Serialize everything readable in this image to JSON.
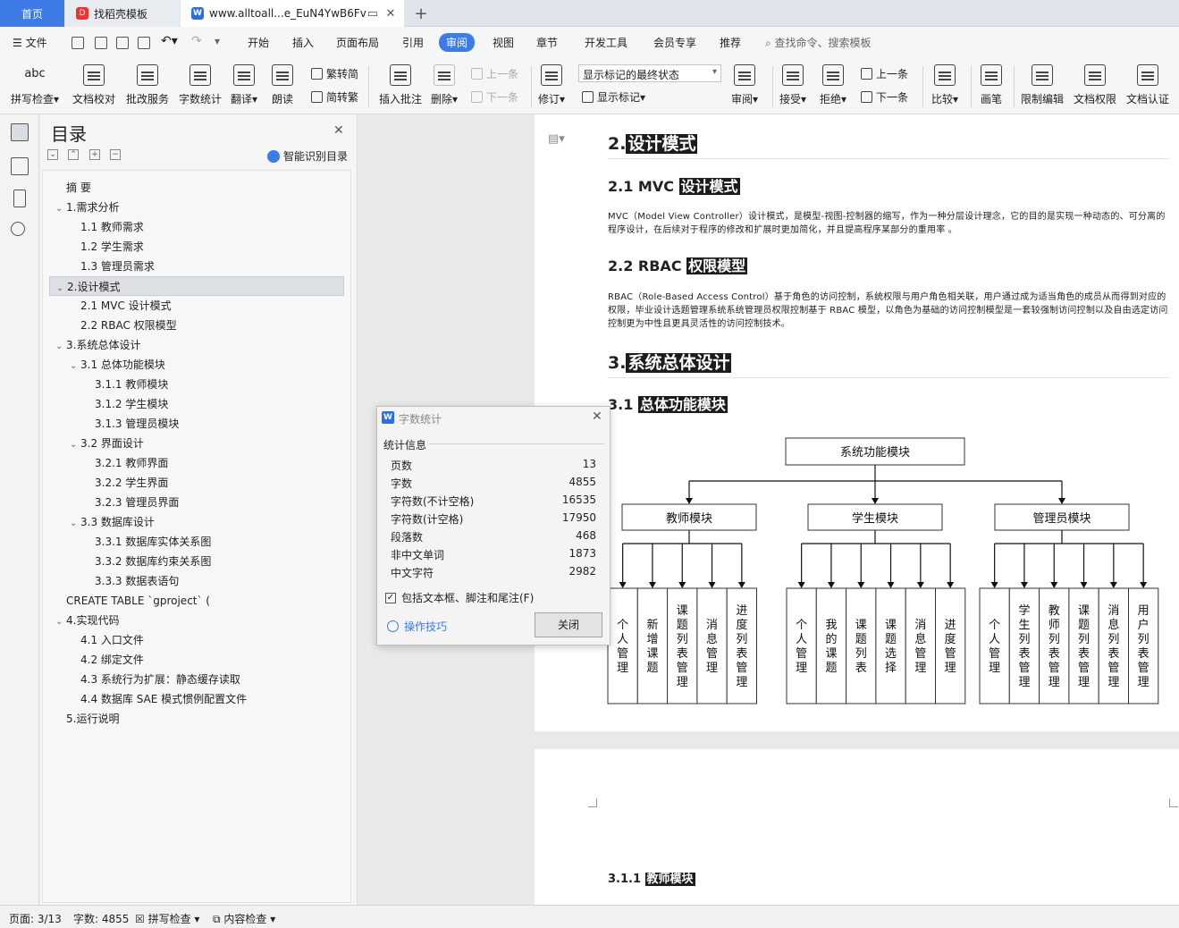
{
  "tabs": {
    "home": "首页",
    "template": "找稻壳模板",
    "doc": "www.alltoall...e_EuN4YwB6Fv"
  },
  "menu": [
    "文件",
    "开始",
    "插入",
    "页面布局",
    "引用",
    "审阅",
    "视图",
    "章节",
    "开发工具",
    "会员专享",
    "推荐"
  ],
  "search_placeholder": "查找命令、搜索模板",
  "ribbon": {
    "spell": "拼写检查",
    "proof": "文档校对",
    "batch": "批改服务",
    "wordcount": "字数统计",
    "translate": "翻译",
    "read": "朗读",
    "trad": "繁转简",
    "simp": "简转繁",
    "insert_comment": "插入批注",
    "delete": "删除",
    "prev_comment": "上一条",
    "next_comment": "下一条",
    "track": "修订",
    "markup_mode": "显示标记的最终状态",
    "show_markup": "显示标记",
    "review": "审阅",
    "accept": "接受",
    "reject": "拒绝",
    "prev_change": "上一条",
    "next_change": "下一条",
    "compare": "比较",
    "pen": "画笔",
    "restrict": "限制编辑",
    "permission": "文档权限",
    "certify": "文档认证",
    "abc": "abc"
  },
  "toc": {
    "title": "目录",
    "smart": "智能识别目录",
    "items": [
      {
        "text": "摘 要",
        "level": 0,
        "caret": ""
      },
      {
        "text": "1.需求分析",
        "level": 0,
        "caret": "v"
      },
      {
        "text": "1.1 教师需求",
        "level": 1,
        "caret": ""
      },
      {
        "text": "1.2 学生需求",
        "level": 1,
        "caret": ""
      },
      {
        "text": "1.3 管理员需求",
        "level": 1,
        "caret": ""
      },
      {
        "text": "2.设计模式",
        "level": 0,
        "caret": "v",
        "selected": true
      },
      {
        "text": "2.1 MVC 设计模式",
        "level": 1,
        "caret": ""
      },
      {
        "text": "2.2 RBAC 权限模型",
        "level": 1,
        "caret": ""
      },
      {
        "text": "3.系统总体设计",
        "level": 0,
        "caret": "v"
      },
      {
        "text": "3.1 总体功能模块",
        "level": 1,
        "caret": "v"
      },
      {
        "text": "3.1.1 教师模块",
        "level": 2,
        "caret": ""
      },
      {
        "text": "3.1.2 学生模块",
        "level": 2,
        "caret": ""
      },
      {
        "text": "3.1.3 管理员模块",
        "level": 2,
        "caret": ""
      },
      {
        "text": "3.2 界面设计",
        "level": 1,
        "caret": "v"
      },
      {
        "text": "3.2.1 教师界面",
        "level": 2,
        "caret": ""
      },
      {
        "text": "3.2.2 学生界面",
        "level": 2,
        "caret": ""
      },
      {
        "text": "3.2.3 管理员界面",
        "level": 2,
        "caret": ""
      },
      {
        "text": "3.3 数据库设计",
        "level": 1,
        "caret": "v"
      },
      {
        "text": "3.3.1 数据库实体关系图",
        "level": 2,
        "caret": ""
      },
      {
        "text": "3.3.2 数据库约束关系图",
        "level": 2,
        "caret": ""
      },
      {
        "text": "3.3.3 数据表语句",
        "level": 2,
        "caret": ""
      },
      {
        "text": "CREATE TABLE `gproject` (",
        "level": 0,
        "caret": ""
      },
      {
        "text": "4.实现代码",
        "level": 0,
        "caret": "v"
      },
      {
        "text": "4.1 入口文件",
        "level": 1,
        "caret": ""
      },
      {
        "text": "4.2 绑定文件",
        "level": 1,
        "caret": ""
      },
      {
        "text": "4.3 系统行为扩展：静态缓存读取",
        "level": 1,
        "caret": ""
      },
      {
        "text": "4.4 数据库 SAE 模式惯例配置文件",
        "level": 1,
        "caret": ""
      },
      {
        "text": "5.运行说明",
        "level": 0,
        "caret": ""
      }
    ]
  },
  "document": {
    "h_2": "2.",
    "h_2_text": "设计模式",
    "h_21": "2.1 MVC",
    "h_21_text": "设计模式",
    "p_mvc": "MVC（Model View Controller）设计模式，是模型-视图-控制器的缩写，作为一种分层设计理念，它的目的是实现一种动态的、可分离的程序设计，在后续对于程序的修改和扩展时更加简化，并且提高程序某部分的重用率 。",
    "h_22": "2.2 RBAC",
    "h_22_text": "权限模型",
    "p_rbac": "RBAC（Role-Based Access Control）基于角色的访问控制，系统权限与用户角色相关联，用户通过成为适当角色的成员从而得到对应的权限，毕业设计选题管理系统系统管理员权限控制基于 RBAC 模型，以角色为基础的访问控制模型是一套较强制访问控制以及自由选定访问控制更为中性且更具灵活性的访问控制技术。",
    "h_3": "3.",
    "h_3_text": "系统总体设计",
    "h_31": "3.1",
    "h_31_text": "总体功能模块",
    "h_311": "3.1.1",
    "h_311_text": "教师模块"
  },
  "diagram": {
    "root": "系统功能模块",
    "groups": [
      {
        "name": "教师模块",
        "children": [
          "个人管理",
          "新增课题",
          "课题列表管理",
          "消息管理",
          "进度列表管理"
        ]
      },
      {
        "name": "学生模块",
        "children": [
          "个人管理",
          "我的课题",
          "课题列表",
          "课题选择",
          "消息管理",
          "进度管理"
        ]
      },
      {
        "name": "管理员模块",
        "children": [
          "个人管理",
          "学生列表管理",
          "教师列表管理",
          "课题列表管理",
          "消息列表管理",
          "用户列表管理"
        ]
      }
    ]
  },
  "wordcount": {
    "title": "字数统计",
    "section": "统计信息",
    "rows": [
      {
        "k": "页数",
        "v": "13"
      },
      {
        "k": "字数",
        "v": "4855"
      },
      {
        "k": "字符数(不计空格)",
        "v": "16535"
      },
      {
        "k": "字符数(计空格)",
        "v": "17950"
      },
      {
        "k": "段落数",
        "v": "468"
      },
      {
        "k": "非中文单词",
        "v": "1873"
      },
      {
        "k": "中文字符",
        "v": "2982"
      }
    ],
    "checkbox": "包括文本框、脚注和尾注(F)",
    "tips": "操作技巧",
    "close": "关闭"
  },
  "status": {
    "page": "页面: 3/13",
    "words": "字数: 4855",
    "spell": "拼写检查",
    "content": "内容检查"
  }
}
